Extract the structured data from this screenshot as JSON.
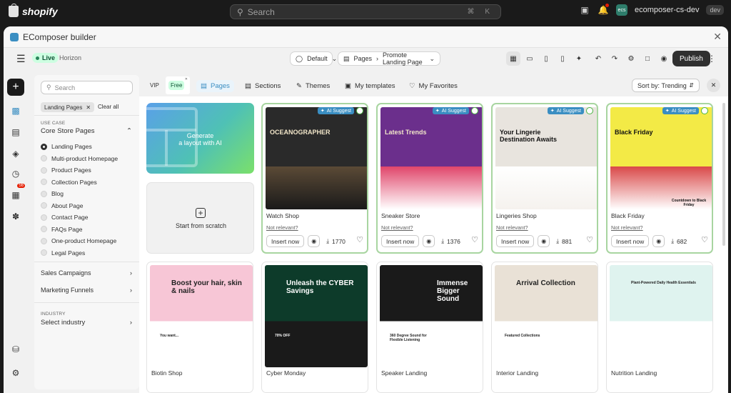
{
  "shopify": {
    "brand": "shopify",
    "search_placeholder": "Search",
    "shortcut": "⌘ K",
    "store_initials": "ecs",
    "store_name": "ecomposer-cs-dev",
    "store_badge": "dev"
  },
  "window": {
    "title": "EComposer builder"
  },
  "toolbar": {
    "status": "Live",
    "theme": "Horizon",
    "template_select": "Default",
    "page_type": "Pages",
    "page_name": "Promote Landing Page",
    "publish_label": "Publish"
  },
  "rail": {
    "notification_count": "56"
  },
  "filters": {
    "search_placeholder": "Search",
    "chip": "Landing Pages",
    "clear_all": "Clear all",
    "use_case_label": "USE CASE",
    "use_case_title": "Core Store Pages",
    "options": [
      {
        "label": "Landing Pages",
        "selected": true
      },
      {
        "label": "Multi-product Homepage",
        "selected": false
      },
      {
        "label": "Product Pages",
        "selected": false
      },
      {
        "label": "Collection Pages",
        "selected": false
      },
      {
        "label": "Blog",
        "selected": false
      },
      {
        "label": "About Page",
        "selected": false
      },
      {
        "label": "Contact Page",
        "selected": false
      },
      {
        "label": "FAQs Page",
        "selected": false
      },
      {
        "label": "One-product Homepage",
        "selected": false
      },
      {
        "label": "Legal Pages",
        "selected": false
      }
    ],
    "sales_campaigns": "Sales Campaigns",
    "marketing_funnels": "Marketing Funnels",
    "industry_label": "INDUSTRY",
    "industry_title": "Select industry"
  },
  "tabs": {
    "vip": "VIP",
    "free": "Free",
    "pages": "Pages",
    "sections": "Sections",
    "themes": "Themes",
    "my_templates": "My templates",
    "my_favorites": "My Favorites",
    "sort_label": "Sort by:",
    "sort_value": "Trending"
  },
  "gen_card": {
    "line1": "Generate",
    "line2": "a layout with AI"
  },
  "scratch_card": {
    "label": "Start from scratch"
  },
  "common": {
    "ai_suggest": "AI Suggest",
    "not_relevant": "Not relevant?",
    "insert_now": "Insert now"
  },
  "templates_top": [
    {
      "name": "Watch Shop",
      "downloads": "1770",
      "thumb_title": "OCEANOGRAPHER",
      "colors": [
        "#2a2a2a",
        "#5b4a36",
        "#1a1a1a"
      ]
    },
    {
      "name": "Sneaker Store",
      "downloads": "1376",
      "thumb_title": "Latest Trends",
      "colors": [
        "#6b2f8c",
        "#e0456a",
        "#ffffff"
      ]
    },
    {
      "name": "Lingeries Shop",
      "downloads": "881",
      "thumb_title": "Your Lingerie Destination Awaits",
      "colors": [
        "#e8e4de",
        "#ffffff",
        "#f5f2ee"
      ]
    },
    {
      "name": "Black Friday",
      "downloads": "682",
      "thumb_title": "Black Friday",
      "extra_text": "Countdown to Black Friday",
      "colors": [
        "#f3ea46",
        "#d94848",
        "#ffffff"
      ]
    }
  ],
  "templates_bottom": [
    {
      "name": "Biotin Shop",
      "thumb_title": "Boost your hair, skin & nails",
      "extra_text": "You want...",
      "colors": [
        "#f7c6d6",
        "#ffffff"
      ]
    },
    {
      "name": "Cyber Monday",
      "thumb_title": "Unleash the CYBER Savings",
      "extra_text": "70% OFF",
      "colors": [
        "#0d3b2a",
        "#1a1a1a"
      ]
    },
    {
      "name": "Speaker Landing",
      "thumb_title": "Immense Bigger Sound",
      "extra_text": "360 Degree Sound for Flexible Listening",
      "colors": [
        "#1a1a1a",
        "#ffffff"
      ]
    },
    {
      "name": "Interior Landing",
      "thumb_title": "Arrival Collection",
      "extra_text": "Featured Collections",
      "colors": [
        "#e9e1d6",
        "#ffffff"
      ]
    },
    {
      "name": "Nutrition Landing",
      "thumb_title": "Plant-Powered Daily Health Essentials",
      "colors": [
        "#dff3ef",
        "#ffffff"
      ]
    }
  ]
}
